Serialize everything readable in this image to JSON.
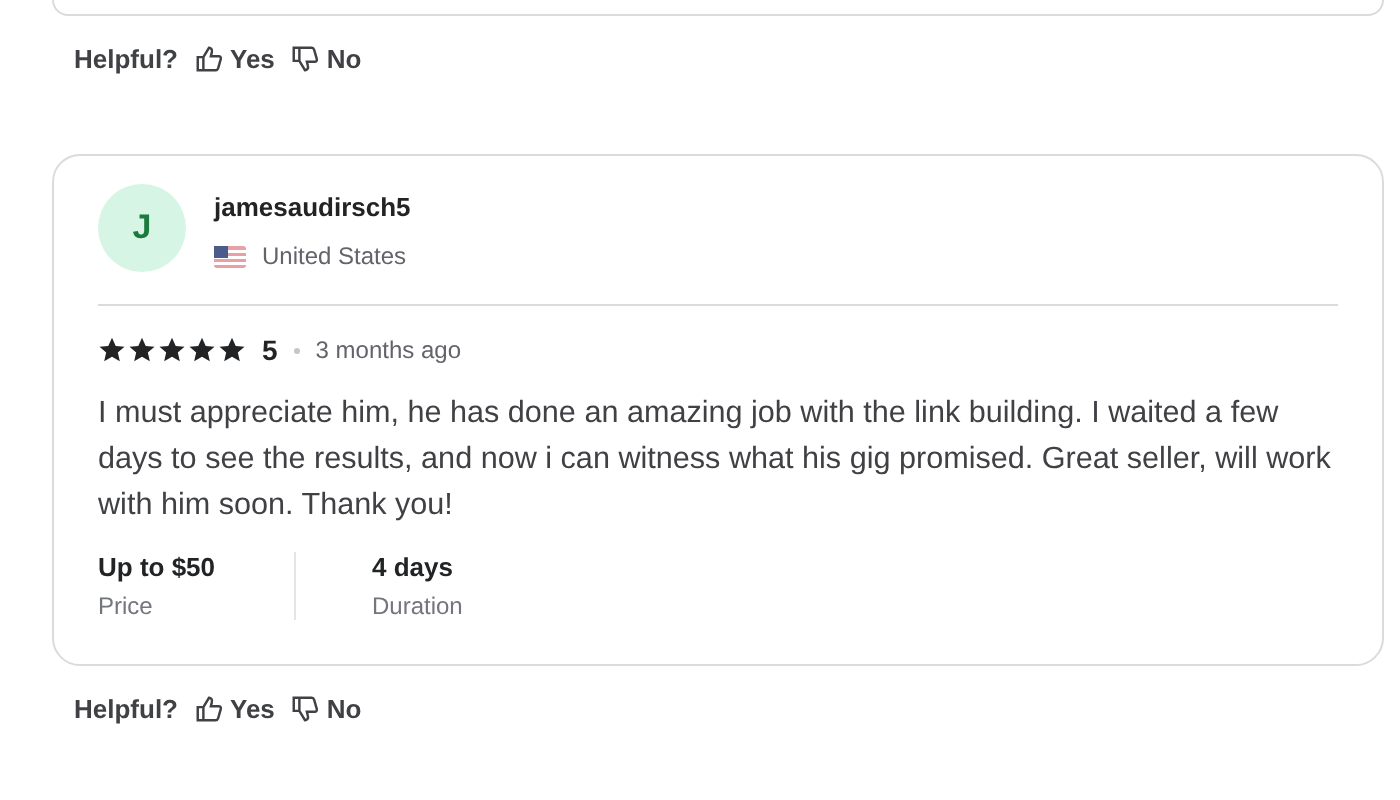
{
  "helpful_top": {
    "label": "Helpful?",
    "yes": "Yes",
    "no": "No"
  },
  "review": {
    "avatar_initial": "J",
    "username": "jamesaudirsch5",
    "country": "United States",
    "stars": 5,
    "rating": "5",
    "time": "3 months ago",
    "text": "I must appreciate him, he has done an amazing job with the link building. I waited a few days to see the results, and now i can witness what his gig promised. Great seller, will work with him soon. Thank you!",
    "details": [
      {
        "value": "Up to $50",
        "label": "Price"
      },
      {
        "value": "4 days",
        "label": "Duration"
      }
    ]
  },
  "helpful_bottom": {
    "label": "Helpful?",
    "yes": "Yes",
    "no": "No"
  }
}
